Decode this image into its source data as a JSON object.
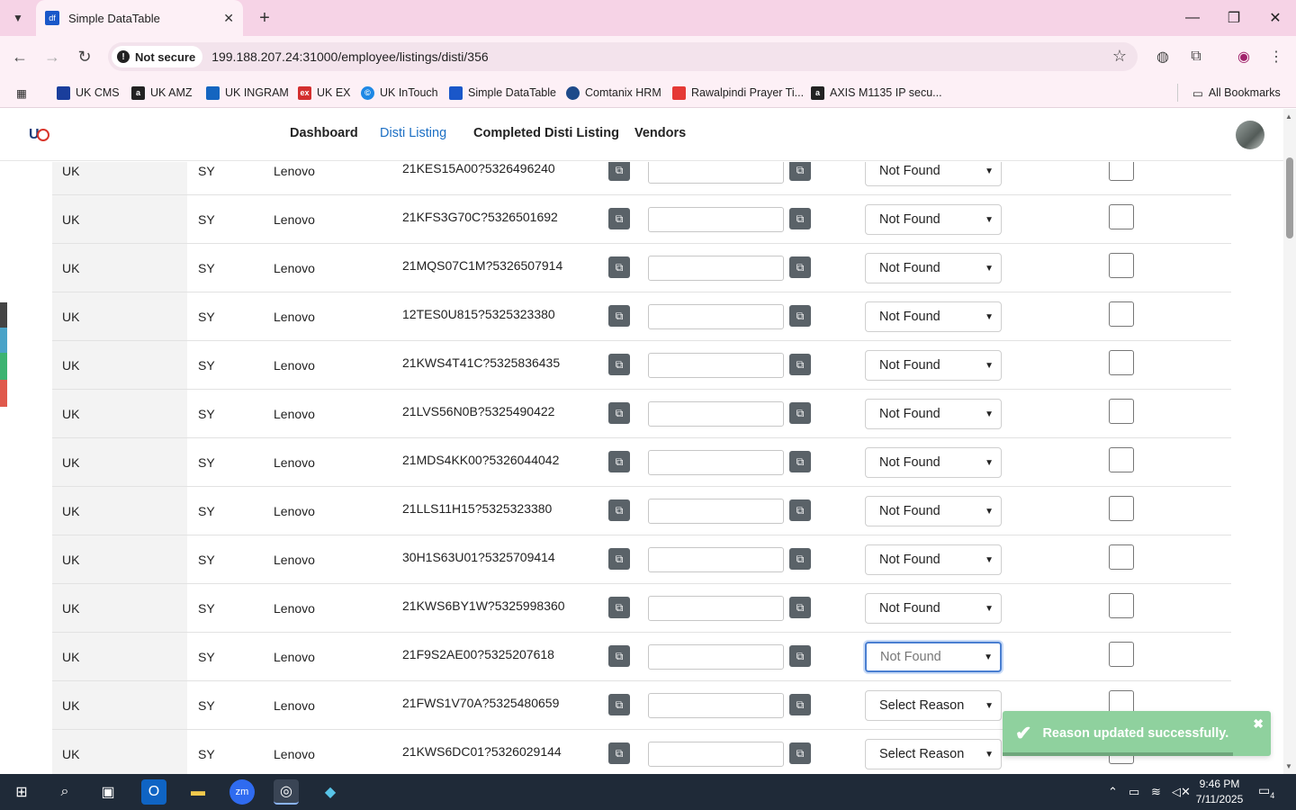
{
  "browser": {
    "tab_title": "Simple DataTable",
    "tab_favicon_text": "df",
    "security_label": "Not secure",
    "url": "199.188.207.24:31000/employee/listings/disti/356",
    "bookmarks": [
      {
        "label": "UK CMS",
        "color": "#1a3e9c",
        "icon": "uk-cms-icon"
      },
      {
        "label": "UK AMZ",
        "color": "#222222",
        "icon": "amazon-icon"
      },
      {
        "label": "UK INGRAM",
        "color": "#1565c0",
        "icon": "ingram-icon"
      },
      {
        "label": "UK EX",
        "color": "#d32f2f",
        "icon": "ex-icon"
      },
      {
        "label": "UK InTouch",
        "color": "#1e88e5",
        "icon": "intouch-icon"
      },
      {
        "label": "Simple DataTable",
        "color": "#1a57c9",
        "icon": "datatable-icon"
      },
      {
        "label": "Comtanix HRM",
        "color": "#1e4a8a",
        "icon": "hrm-icon"
      },
      {
        "label": "Rawalpindi Prayer Ti...",
        "color": "#e53935",
        "icon": "prayer-icon"
      },
      {
        "label": "AXIS M1135 IP secu...",
        "color": "#222222",
        "icon": "axis-icon"
      }
    ],
    "all_bookmarks_label": "All Bookmarks"
  },
  "app": {
    "nav": [
      "Dashboard",
      "Disti Listing",
      "Completed Disti Listing",
      "Vendors"
    ],
    "active_nav": "Disti Listing"
  },
  "table": {
    "rows": [
      {
        "country": "UK",
        "code": "SY",
        "brand": "Lenovo",
        "sku": "21KES15A00?5326496240",
        "reason": "Not Found"
      },
      {
        "country": "UK",
        "code": "SY",
        "brand": "Lenovo",
        "sku": "21KFS3G70C?5326501692",
        "reason": "Not Found"
      },
      {
        "country": "UK",
        "code": "SY",
        "brand": "Lenovo",
        "sku": "21MQS07C1M?5326507914",
        "reason": "Not Found"
      },
      {
        "country": "UK",
        "code": "SY",
        "brand": "Lenovo",
        "sku": "12TES0U815?5325323380",
        "reason": "Not Found"
      },
      {
        "country": "UK",
        "code": "SY",
        "brand": "Lenovo",
        "sku": "21KWS4T41C?5325836435",
        "reason": "Not Found"
      },
      {
        "country": "UK",
        "code": "SY",
        "brand": "Lenovo",
        "sku": "21LVS56N0B?5325490422",
        "reason": "Not Found"
      },
      {
        "country": "UK",
        "code": "SY",
        "brand": "Lenovo",
        "sku": "21MDS4KK00?5326044042",
        "reason": "Not Found"
      },
      {
        "country": "UK",
        "code": "SY",
        "brand": "Lenovo",
        "sku": "21LLS11H15?5325323380",
        "reason": "Not Found"
      },
      {
        "country": "UK",
        "code": "SY",
        "brand": "Lenovo",
        "sku": "30H1S63U01?5325709414",
        "reason": "Not Found"
      },
      {
        "country": "UK",
        "code": "SY",
        "brand": "Lenovo",
        "sku": "21KWS6BY1W?5325998360",
        "reason": "Not Found"
      },
      {
        "country": "UK",
        "code": "SY",
        "brand": "Lenovo",
        "sku": "21F9S2AE00?5325207618",
        "reason": "Not Found",
        "focused": true
      },
      {
        "country": "UK",
        "code": "SY",
        "brand": "Lenovo",
        "sku": "21FWS1V70A?5325480659",
        "reason": "Select Reason"
      },
      {
        "country": "UK",
        "code": "SY",
        "brand": "Lenovo",
        "sku": "21KWS6DC01?5326029144",
        "reason": "Select Reason"
      }
    ]
  },
  "toast": {
    "message": "Reason updated successfully.",
    "color": "#8fd19e"
  },
  "taskbar": {
    "time": "9:46 PM",
    "date": "7/11/2025",
    "notification_count": "4"
  }
}
